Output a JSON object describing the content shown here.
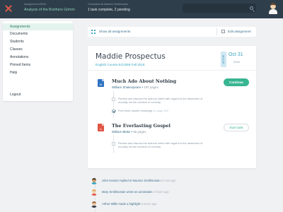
{
  "topbar": {
    "assignment_meta": "Assignment #001b",
    "assignment_title": "Analysis of the Brothers Grimm",
    "connection_label": "Connected as Maurice Smithsonian",
    "task_status": "1 task complete, 2 pending",
    "search_placeholder": ""
  },
  "sidebar": {
    "items": [
      {
        "label": "Assignments"
      },
      {
        "label": "Documents"
      },
      {
        "label": "Students"
      },
      {
        "label": "Classes"
      },
      {
        "label": "Annotations"
      },
      {
        "label": "Pinned Items"
      },
      {
        "label": "Help"
      },
      {
        "label": "Logout"
      }
    ]
  },
  "main_header": {
    "show_all_label": "Show all assignments",
    "edit_label": "Edit assignment"
  },
  "card": {
    "student_name": "Maddie Prospectus",
    "course": "English Course EG2365 Fall 2016",
    "status_badge": "ACTIVE",
    "date_month": "Oct 31",
    "date_year": "2016",
    "documents": [
      {
        "type_glyph": "W",
        "title": "Much Ado About Nothing",
        "author": "William Shakespeare",
        "pages": "197 pages",
        "button": "Continue",
        "tasks": [
          {
            "text": "Review and discuss the authors intent with regard to the dissection of morality via the medium of comedy",
            "ref": "",
            "checked": false
          },
          {
            "text": "Find three double meanings",
            "ref": "on page 310",
            "checked": true
          }
        ]
      },
      {
        "type_glyph": "A",
        "title": "The Everlasting Gospel",
        "author": "William Blake",
        "pages": "55 pages",
        "button": "Start task",
        "tasks": [
          {
            "text": "Review and discuss the authors intent with regard to the dissection of morality via the medium of comedy",
            "ref": "",
            "checked": false
          }
        ]
      }
    ]
  },
  "activity": [
    {
      "text": "John Kramer replied to Maurice Smithsonian",
      "time": "8 mins ago"
    },
    {
      "text": "Mary Smithsonian wrote an annotation",
      "time": "2 hours ago"
    },
    {
      "text": "Arthur Willis made a highlight",
      "time": "5 hours ago"
    }
  ],
  "colors": {
    "accent": "#38b591",
    "link": "#3b6f8c",
    "topbar": "#2f3e4b",
    "pdf": "#e15443",
    "word": "#2f72c2"
  },
  "icons": [
    "close-icon",
    "search-icon",
    "grid-icon",
    "edit-icon",
    "word-document-icon",
    "pdf-document-icon",
    "checkbox-icon"
  ]
}
